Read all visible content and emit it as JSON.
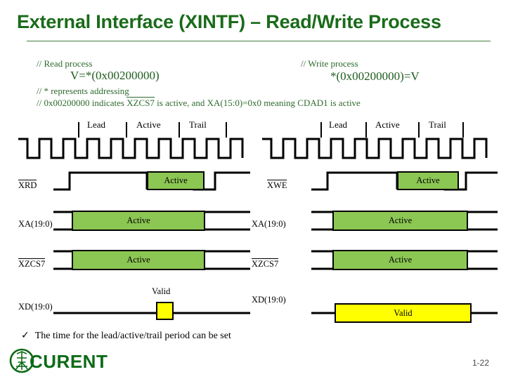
{
  "slide": {
    "title": "External Interface (XINTF) – Read/Write Process",
    "page_number": "1-22",
    "accent_green": "#1a6b1a",
    "active_box_color": "#8CC653",
    "valid_box_color": "#FFFF00"
  },
  "code": {
    "read_comment": "// Read process",
    "read_stmt": "V=*(0x00200000)",
    "note_star": "// * represents addressing",
    "note_addr_prefix": "// 0x00200000 indicates ",
    "note_addr_signal": "XZCS7",
    "note_addr_suffix": " is active, and XA(15:0)=0x0 meaning CDAD1 is active",
    "write_comment": "// Write process",
    "write_stmt": "*(0x00200000)=V"
  },
  "diagram": {
    "phases": [
      "Lead",
      "Active",
      "Trail"
    ],
    "active_label": "Active",
    "valid_label": "Valid",
    "read": {
      "title": "read-timing-diagram",
      "rows": [
        {
          "name": "XRD",
          "overline": true,
          "type": "pulse",
          "fill": "Active"
        },
        {
          "name": "XA(19:0)",
          "overline": false,
          "type": "bus",
          "fill": "Active"
        },
        {
          "name": "XZCS7",
          "overline": true,
          "type": "bus",
          "fill": "Active"
        },
        {
          "name": "XD(19:0)",
          "overline": false,
          "type": "data",
          "fill": "Valid"
        }
      ]
    },
    "write": {
      "title": "write-timing-diagram",
      "rows": [
        {
          "name": "XWE",
          "overline": true,
          "type": "pulse",
          "fill": "Active"
        },
        {
          "name": "XA(19:0)",
          "overline": false,
          "type": "bus",
          "fill": "Active"
        },
        {
          "name": "XZCS7",
          "overline": true,
          "type": "bus",
          "fill": "Active"
        },
        {
          "name": "XD(19:0)",
          "overline": false,
          "type": "data",
          "fill": "Valid"
        }
      ]
    }
  },
  "footer": {
    "bullet_glyph": "✓",
    "bullet_text": "The time for the lead/active/trail period can be set",
    "logo_text": "CURENT"
  }
}
